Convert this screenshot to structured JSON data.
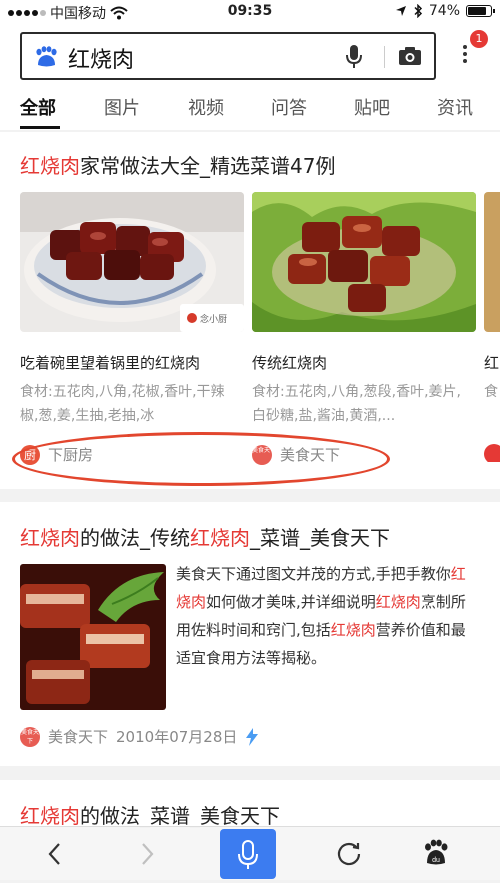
{
  "status": {
    "carrier": "中国移动",
    "time": "09:35",
    "battery": "74%",
    "battery_level": 0.74
  },
  "search": {
    "query": "红烧肉",
    "notification_count": "1"
  },
  "tabs": [
    {
      "label": "全部",
      "active": true
    },
    {
      "label": "图片"
    },
    {
      "label": "视频"
    },
    {
      "label": "问答"
    },
    {
      "label": "贴吧"
    },
    {
      "label": "资讯"
    }
  ],
  "result1": {
    "title_hl": "红烧肉",
    "title_rest": "家常做法大全_精选菜谱47例",
    "recipes": [
      {
        "name": "吃着碗里望着锅里的红烧肉",
        "ingredients": "食材:五花肉,八角,花椒,香叶,干辣椒,葱,姜,生抽,老抽,冰",
        "source": "下厨房",
        "source_icon": "厨",
        "watermark": "念小厨"
      },
      {
        "name": "传统红烧肉",
        "ingredients": "食材:五花肉,八角,葱段,香叶,姜片,白砂糖,盐,酱油,黄酒,...",
        "source": "美食天下",
        "source_icon": "美食天下"
      }
    ],
    "peek_name": "红",
    "peek_ing": "食"
  },
  "result2": {
    "title": [
      {
        "t": "红烧肉",
        "hl": true
      },
      {
        "t": "的做法_传统",
        "hl": false
      },
      {
        "t": "红烧肉",
        "hl": true
      },
      {
        "t": "_菜谱_美食天下",
        "hl": false
      }
    ],
    "desc": [
      {
        "t": "美食天下通过图文并茂的方式,手把手教你",
        "hl": false
      },
      {
        "t": "红烧肉",
        "hl": true
      },
      {
        "t": "如何做才美味,并详细说明",
        "hl": false
      },
      {
        "t": "红烧肉",
        "hl": true
      },
      {
        "t": "烹制所用佐料时间和窍门,包括",
        "hl": false
      },
      {
        "t": "红烧肉",
        "hl": true
      },
      {
        "t": "营养价值和最适宜食用方法等揭秘。",
        "hl": false
      }
    ],
    "source": "美食天下",
    "date": "2010年07月28日"
  },
  "result3": {
    "title": [
      {
        "t": "红烧肉",
        "hl": true
      },
      {
        "t": "的做法_菜谱_美食天下",
        "hl": false
      }
    ]
  },
  "colors": {
    "highlight": "#e53935",
    "voice_button": "#3c7cf0",
    "annotation_oval": "#e2462e"
  },
  "icons": [
    "baidu-paw-icon",
    "microphone-icon",
    "camera-icon",
    "more-icon",
    "back-icon",
    "forward-icon",
    "voice-icon",
    "reload-icon",
    "home-icon",
    "lightning-icon"
  ]
}
